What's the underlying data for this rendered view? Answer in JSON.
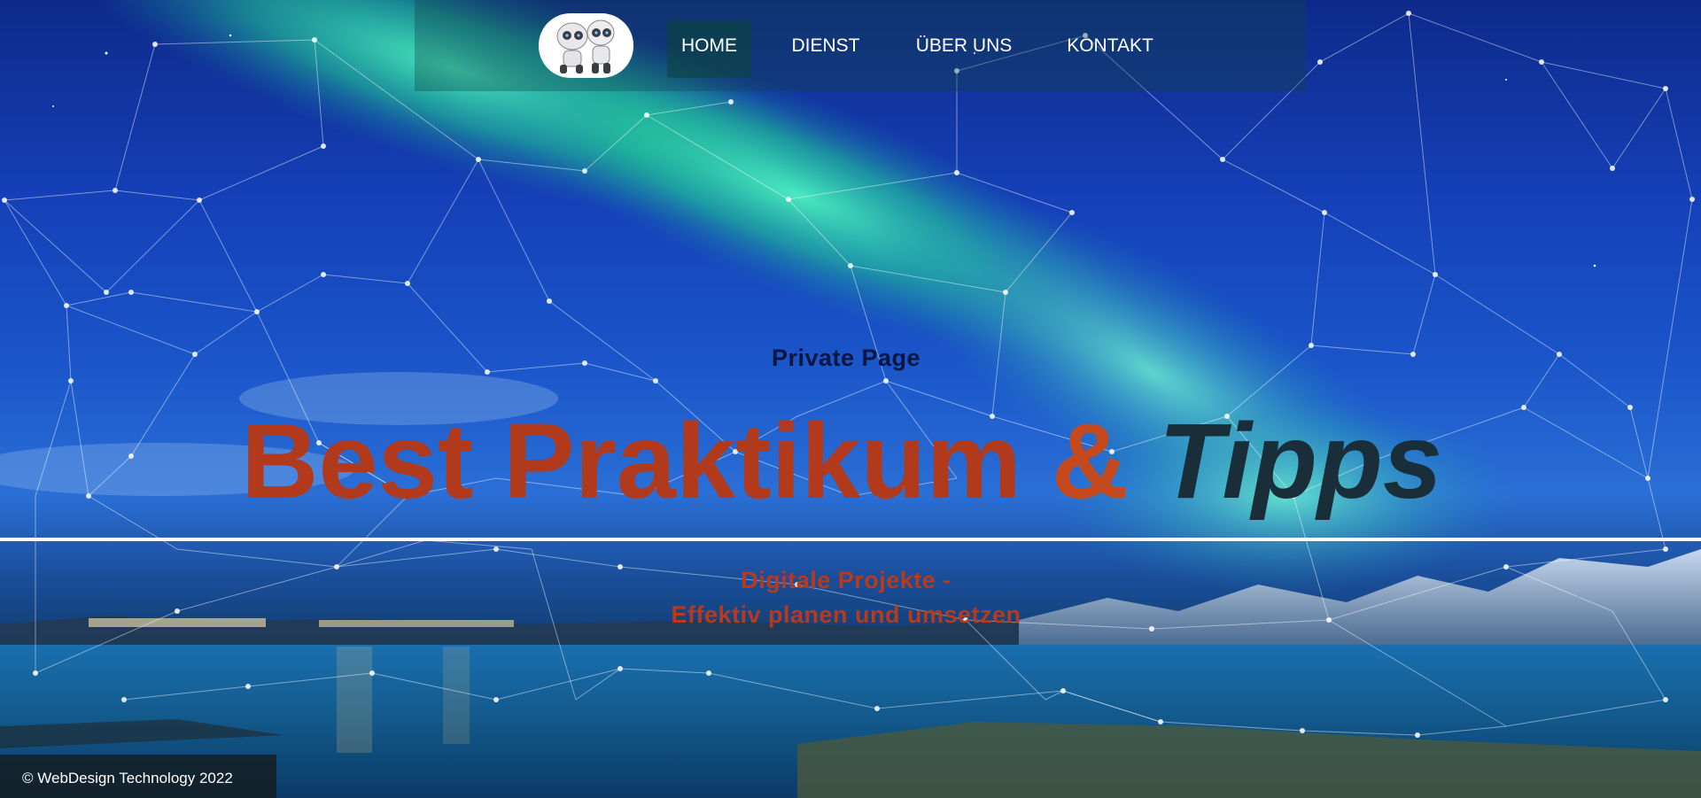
{
  "nav": {
    "items": [
      {
        "label": "HOME",
        "active": true
      },
      {
        "label": "DIENST",
        "active": false
      },
      {
        "label": "ÜBER UNS",
        "active": false
      },
      {
        "label": "KONTAKT",
        "active": false
      }
    ],
    "logo_icon": "robots-logo-icon"
  },
  "hero": {
    "private_label": "Private Page",
    "headline_part1": "Best Praktikum",
    "headline_part2": "&",
    "headline_part3": "Tipps",
    "subtitle_line1": "Digitale Projekte -",
    "subtitle_line2": "Effektiv planen und umsetzen"
  },
  "footer": {
    "text": "© WebDesign Technology 2022"
  },
  "colors": {
    "headline": "#b23a1c",
    "tipps": "#1a2e3a",
    "subtitle": "#b83a1c",
    "sky": "#1540b8",
    "aurora": "#1fd8a0"
  },
  "background": {
    "aurora_icon": "aurora-background",
    "network_icon": "network-lines-overlay"
  }
}
